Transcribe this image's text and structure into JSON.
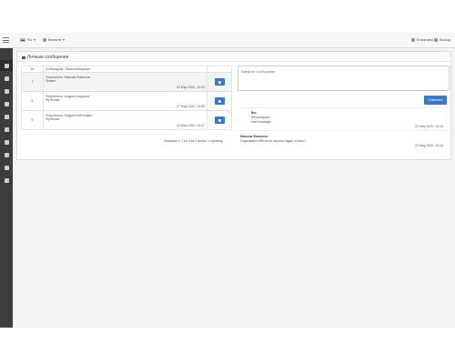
{
  "topbar": {
    "language": "Ru",
    "currency": "Валюта",
    "cart": "В корзину",
    "logout": "Выход"
  },
  "panel": {
    "title": "Личные сообщения"
  },
  "table": {
    "headers": [
      "№",
      "Собеседник, Тема сообщения",
      ""
    ],
    "rows": [
      {
        "num": "7",
        "line1": "Покупатель: Максим Фамилия",
        "line2": "Привет",
        "date": "22 May 2020, 13:43"
      },
      {
        "num": "6",
        "line1": "Покупатель: Андрей Сидоров",
        "line2": "Футболка",
        "date": "27 May 2020, 20:55"
      },
      {
        "num": "5",
        "line1": "Покупатель: Андрей Кабоходин",
        "line2": "Футболка",
        "date": "22 May 2020, 13:27"
      }
    ]
  },
  "pagination": "Показано с 1 по 3 из 3 (всего 1 страниц)",
  "compose": {
    "placeholder": "Введите сообщение",
    "send_label": "Отметить"
  },
  "conversation": [
    {
      "author": "Вы",
      "line1": "Мессенджер",
      "line2": "new message",
      "date": "22 May 2020, 13:44"
    },
    {
      "author": "Максим Фамилия",
      "line1": "Подскажите 880 штук сколько будет стоить?",
      "line2": "",
      "date": "22 May 2020, 13:43"
    }
  ]
}
